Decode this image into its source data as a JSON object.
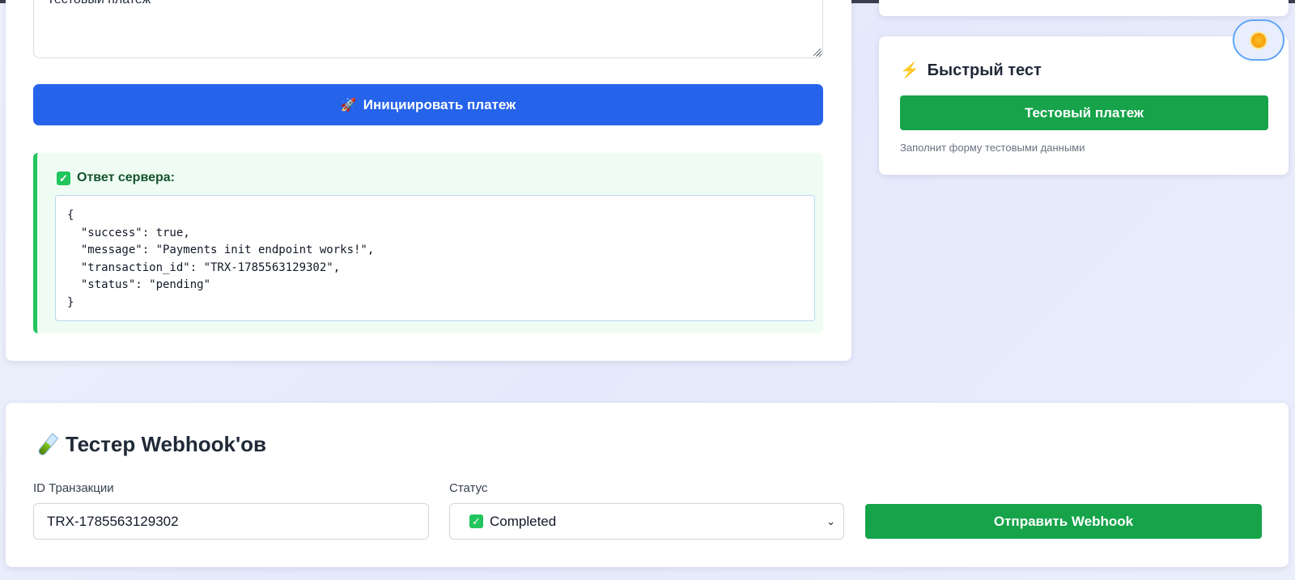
{
  "payment_form": {
    "description_value": "Тестовый платеж",
    "init_button_label": "Инициировать платеж",
    "response": {
      "title": "Ответ сервера:",
      "code_lines": [
        "{",
        "  \"success\": true,",
        "  \"message\": \"Payments init endpoint works!\",",
        "  \"transaction_id\": \"TRX-1785563129302\",",
        "  \"status\": \"pending\"",
        "}"
      ]
    }
  },
  "quick_test": {
    "title": "Быстрый тест",
    "button_label": "Тестовый платеж",
    "hint": "Заполнит форму тестовыми данными"
  },
  "webhook_tester": {
    "title": "Тестер Webhook'ов",
    "transaction_label": "ID Транзакции",
    "transaction_value": "TRX-1785563129302",
    "status_label": "Статус",
    "status_selected": "Completed",
    "send_button_label": "Отправить Webhook"
  },
  "icons": {
    "rocket": "rocket-icon",
    "check": "check-icon",
    "bolt": "lightning-bolt-icon",
    "sun": "sun-icon",
    "test_tube": "test-tube-icon",
    "chevron": "chevron-down-icon"
  },
  "colors": {
    "primary_blue": "#2563eb",
    "success_green": "#16a34a",
    "response_bg": "#effcf3",
    "response_border": "#22c55e"
  }
}
